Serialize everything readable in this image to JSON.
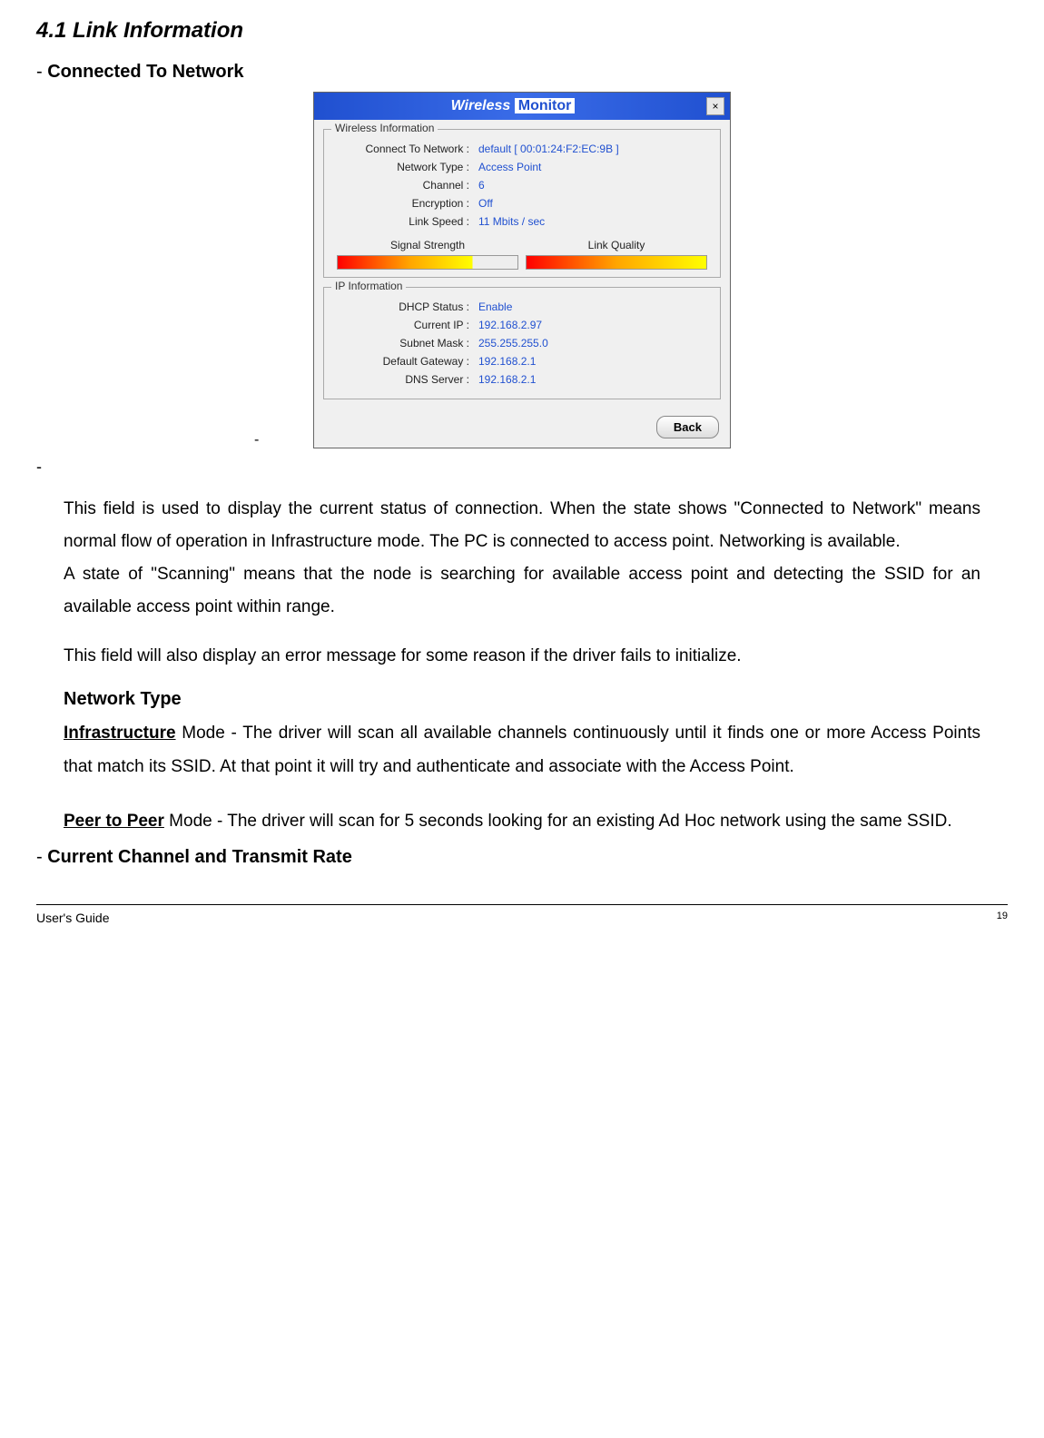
{
  "section_title": "4.1 Link Information",
  "bullets": {
    "connected_to_network": "Connected To Network",
    "current_channel": "Current Channel and Transmit Rate"
  },
  "monitor": {
    "title_wireless": "Wireless",
    "title_monitor": "Monitor",
    "close": "×",
    "wireless_info": {
      "group_title": "Wireless Information",
      "connect_label": "Connect To Network :",
      "connect_value": "default [ 00:01:24:F2:EC:9B ]",
      "network_type_label": "Network Type :",
      "network_type_value": "Access Point",
      "channel_label": "Channel :",
      "channel_value": "6",
      "encryption_label": "Encryption :",
      "encryption_value": "Off",
      "link_speed_label": "Link Speed :",
      "link_speed_value": "11 Mbits / sec",
      "signal_strength_label": "Signal Strength",
      "link_quality_label": "Link Quality"
    },
    "ip_info": {
      "group_title": "IP Information",
      "dhcp_label": "DHCP Status :",
      "dhcp_value": "Enable",
      "ip_label": "Current IP :",
      "ip_value": "192.168.2.97",
      "subnet_label": "Subnet Mask :",
      "subnet_value": "255.255.255.0",
      "gateway_label": "Default Gateway :",
      "gateway_value": "192.168.2.1",
      "dns_label": "DNS Server :",
      "dns_value": "192.168.2.1"
    },
    "back_button": "Back"
  },
  "paragraphs": {
    "p1a": "This field is used to display the current status of connection. When the state shows \"Connected to Network\" means normal flow of operation in Infrastructure mode. The PC is connected to access point.  Networking is available.",
    "p1b": "A state of \"Scanning\" means that the node is searching for available access point and detecting the SSID for an available access point within range.",
    "p2": "This field will also display an error message for some reason if the driver fails to initialize.",
    "network_type_heading": "Network Type",
    "infra_label": "Infrastructure",
    "infra_rest": " Mode   - The driver will scan all available channels continuously until it finds one or more Access Points that match its SSID.  At that point it will try and authenticate and associate with the Access Point.",
    "p2p_label": "Peer to Peer",
    "p2p_rest": " Mode   - The driver will scan for 5 seconds looking for an existing Ad Hoc network using the same SSID."
  },
  "footer": {
    "guide": "User's Guide",
    "page": "19"
  }
}
